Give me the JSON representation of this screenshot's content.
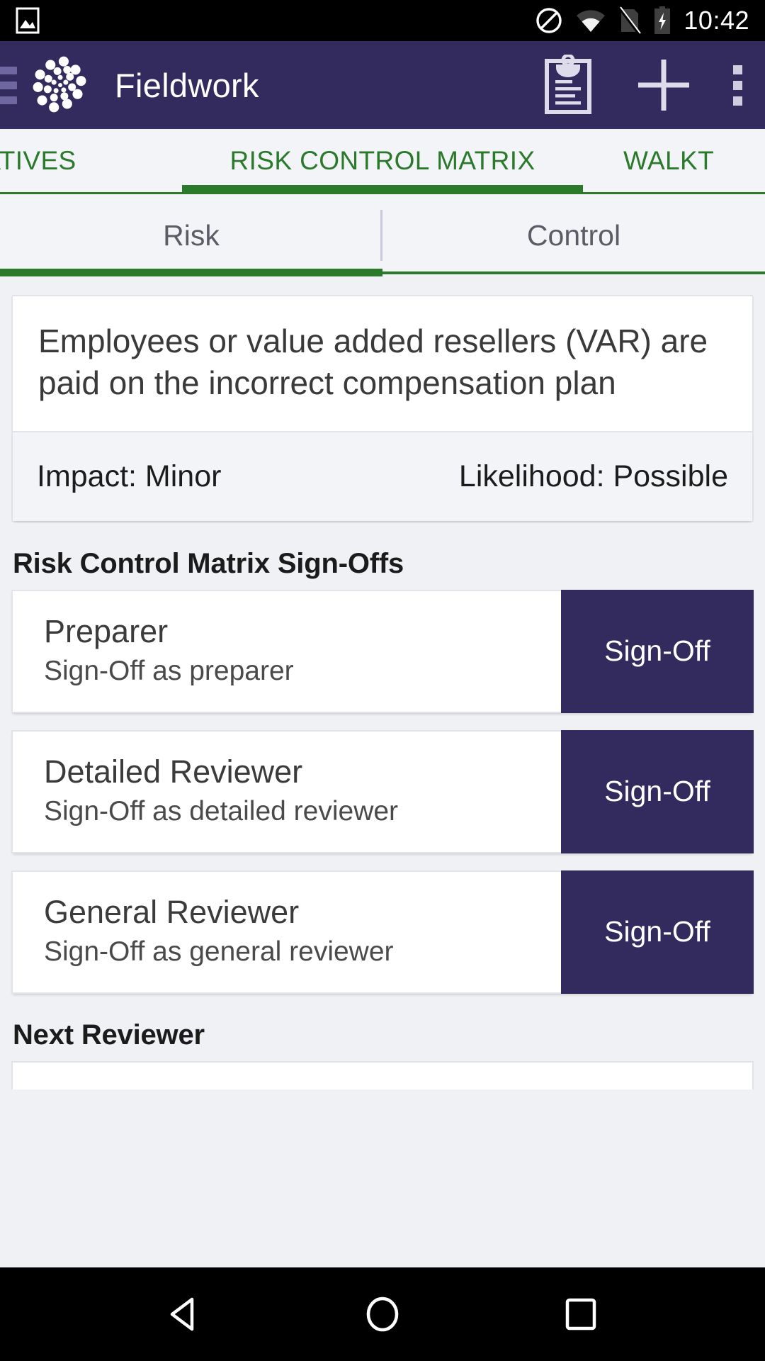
{
  "status_bar": {
    "clock": "10:42",
    "icons": [
      "image-icon",
      "do-not-disturb-icon",
      "wifi-icon",
      "no-sim-icon",
      "battery-charging-icon"
    ]
  },
  "app_bar": {
    "title": "Fieldwork",
    "menu_icon": "hamburger-menu-icon",
    "logo_icon": "fieldwork-logo-icon",
    "actions": [
      {
        "name": "clipboard-icon",
        "label": "Clipboard"
      },
      {
        "name": "add-icon",
        "label": "Add"
      },
      {
        "name": "overflow-menu-icon",
        "label": "More options"
      }
    ],
    "background": "#332b5e"
  },
  "main_tabs": {
    "previous": "ATIVES",
    "current": "RISK CONTROL MATRIX",
    "next": "WALKT",
    "accent": "#2b7a2b"
  },
  "sub_tabs": {
    "items": [
      {
        "label": "Risk",
        "selected": true
      },
      {
        "label": "Control",
        "selected": false
      }
    ]
  },
  "risk": {
    "description": "Employees or value added resellers (VAR) are paid on the incorrect compensation plan",
    "impact": "Impact: Minor",
    "likelihood": "Likelihood: Possible"
  },
  "signoffs": {
    "section_title": "Risk Control Matrix Sign-Offs",
    "rows": [
      {
        "title": "Preparer",
        "subtitle": "Sign-Off as preparer",
        "button": "Sign-Off"
      },
      {
        "title": "Detailed Reviewer",
        "subtitle": "Sign-Off as detailed reviewer",
        "button": "Sign-Off"
      },
      {
        "title": "General Reviewer",
        "subtitle": "Sign-Off as general reviewer",
        "button": "Sign-Off"
      }
    ]
  },
  "next_reviewer": {
    "section_title": "Next Reviewer"
  },
  "nav_bar": {
    "back": "back-nav-icon",
    "home": "home-nav-icon",
    "recents": "recents-nav-icon"
  }
}
